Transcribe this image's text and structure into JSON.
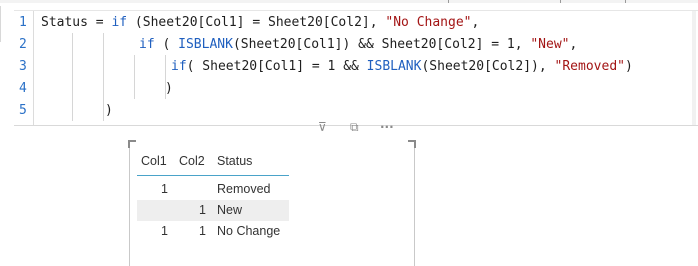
{
  "editor": {
    "line_numbers": [
      "1",
      "2",
      "3",
      "4",
      "5"
    ],
    "lines": [
      [
        {
          "t": "Status = "
        },
        {
          "t": "if",
          "c": "fn"
        },
        {
          "t": " (Sheet20[Col1] = Sheet20[Col2], "
        },
        {
          "t": "\"No Change\"",
          "c": "str"
        },
        {
          "t": ","
        }
      ],
      [
        {
          "t": "if",
          "c": "fn"
        },
        {
          "t": " ( "
        },
        {
          "t": "ISBLANK",
          "c": "fn"
        },
        {
          "t": "(Sheet20[Col1]) && Sheet20[Col2] = 1, "
        },
        {
          "t": "\"New\"",
          "c": "str"
        },
        {
          "t": ","
        }
      ],
      [
        {
          "t": "if",
          "c": "fn"
        },
        {
          "t": "( Sheet20[Col1] = 1 && "
        },
        {
          "t": "ISBLANK",
          "c": "fn"
        },
        {
          "t": "(Sheet20[Col2]), "
        },
        {
          "t": "\"Removed\"",
          "c": "str"
        },
        {
          "t": ")"
        }
      ],
      [
        {
          "t": ")"
        }
      ],
      [
        {
          "t": ")"
        }
      ]
    ]
  },
  "visual_header": {
    "icons": [
      "filter-icon",
      "focus-mode-icon",
      "more-options-icon"
    ],
    "glyphs": [
      "⊽",
      "⧉",
      "···"
    ]
  },
  "table": {
    "columns": [
      "Col1",
      "Col2",
      "Status"
    ],
    "rows": [
      {
        "col1": "1",
        "col2": "",
        "status": "Removed"
      },
      {
        "col1": "",
        "col2": "1",
        "status": "New"
      },
      {
        "col1": "1",
        "col2": "1",
        "status": "No Change"
      }
    ]
  }
}
